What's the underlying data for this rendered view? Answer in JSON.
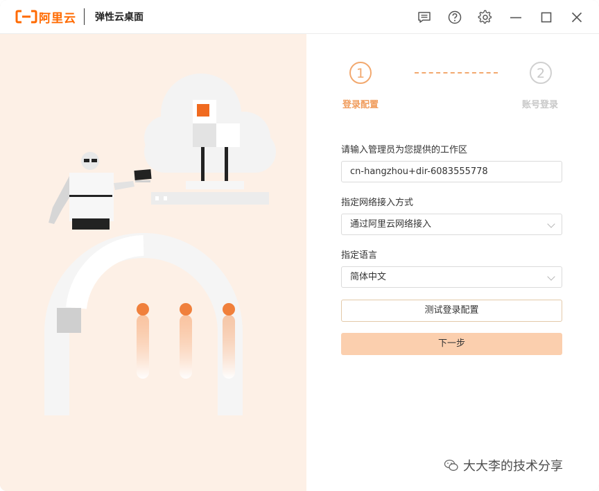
{
  "titlebar": {
    "brand": "阿里云",
    "app_title": "弹性云桌面",
    "icons": [
      "message-icon",
      "help-icon",
      "settings-icon",
      "minimize-icon",
      "maximize-icon",
      "close-icon"
    ]
  },
  "steps": [
    {
      "number": "1",
      "label": "登录配置",
      "state": "active"
    },
    {
      "number": "2",
      "label": "账号登录",
      "state": "inactive"
    }
  ],
  "form": {
    "workspace_label": "请输入管理员为您提供的工作区",
    "workspace_value": "cn-hangzhou+dir-6083555778",
    "network_label": "指定网络接入方式",
    "network_value": "通过阿里云网络接入",
    "language_label": "指定语言",
    "language_value": "简体中文",
    "test_button": "测试登录配置",
    "next_button": "下一步"
  },
  "watermark": "大大李的技术分享",
  "colors": {
    "brand": "#ff6a00",
    "accent": "#f2a86e",
    "primary_button": "#fbcfae",
    "illustration_bg": "#fdf0e6"
  }
}
